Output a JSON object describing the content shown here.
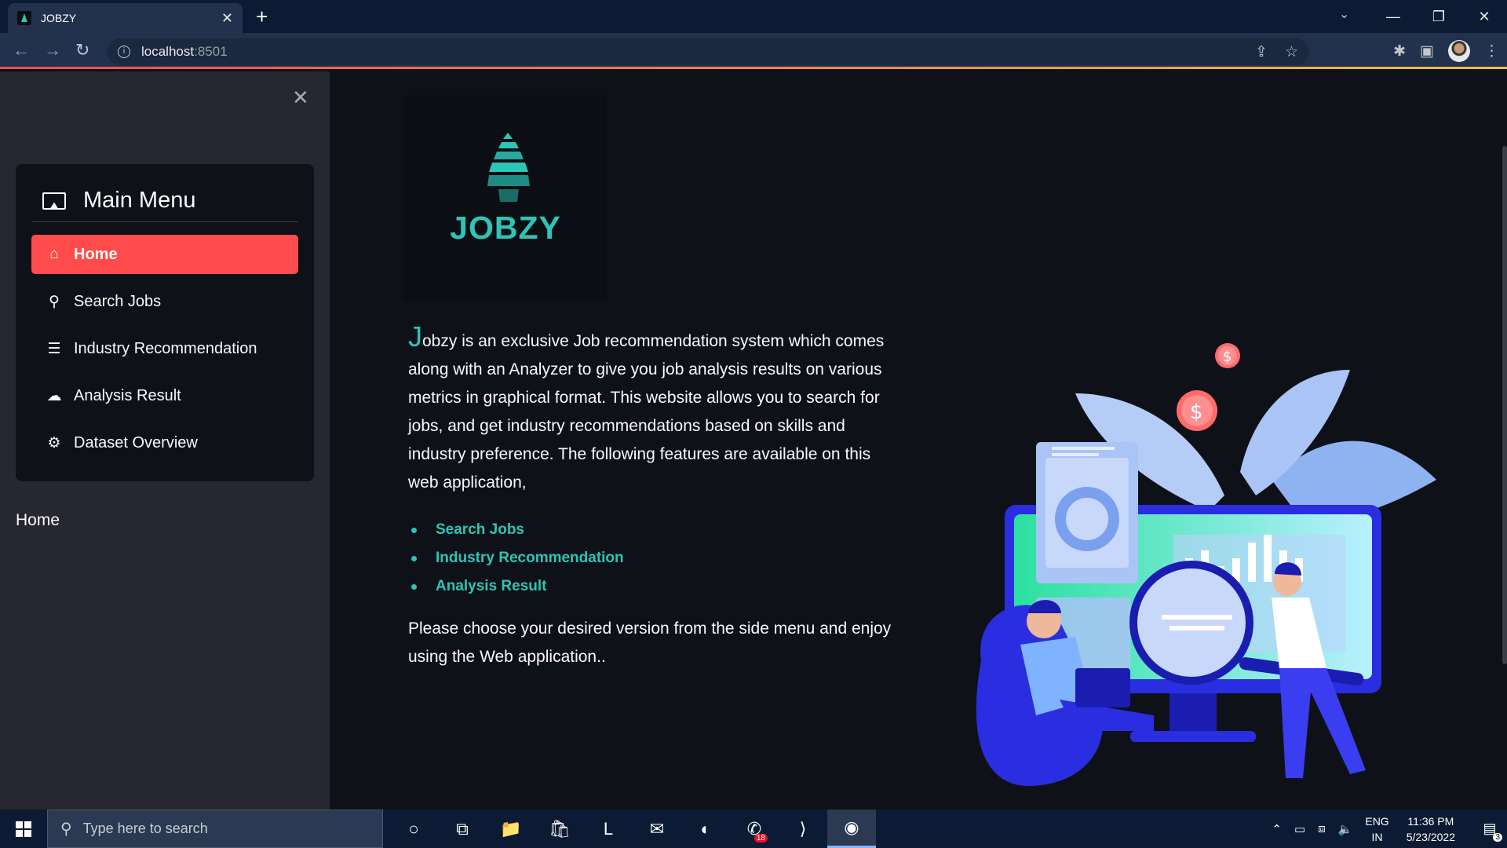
{
  "browser": {
    "tab_title": "JOBZY",
    "tab_close": "✕",
    "new_tab": "+",
    "url_host": "localhost",
    "url_port": ":8501",
    "win_minimize": "—",
    "win_restore": "❐",
    "win_close": "✕"
  },
  "sidebar": {
    "close": "✕",
    "menu_title": "Main Menu",
    "items": [
      {
        "label": "Home",
        "icon": "home-icon",
        "glyph": "⌂",
        "active": true
      },
      {
        "label": "Search Jobs",
        "icon": "search-icon",
        "glyph": "⚲",
        "active": false
      },
      {
        "label": "Industry Recommendation",
        "icon": "list-icon",
        "glyph": "☰",
        "active": false
      },
      {
        "label": "Analysis Result",
        "icon": "cloud-upload-icon",
        "glyph": "☁",
        "active": false
      },
      {
        "label": "Dataset Overview",
        "icon": "gear-icon",
        "glyph": "⚙",
        "active": false
      }
    ],
    "current_page": "Home"
  },
  "main": {
    "logo_text": "JOBZY",
    "intro_dropcap": "J",
    "intro_text": "obzy is an exclusive Job recommendation system which comes along with an Analyzer to give you job analysis results on various metrics in graphical format. This website allows you to search for jobs, and get industry recommendations based on skills and industry preference. The following features are available on this web application,",
    "features": [
      "Search Jobs",
      "Industry Recommendation",
      "Analysis Result"
    ],
    "closing": "Please choose your desired version from the side menu and enjoy using the Web application.."
  },
  "taskbar": {
    "search_placeholder": "Type here to search",
    "apps": [
      {
        "name": "cortana-icon",
        "glyph": "○"
      },
      {
        "name": "task-view-icon",
        "glyph": "⧉"
      },
      {
        "name": "file-explorer-icon",
        "glyph": "📁"
      },
      {
        "name": "store-icon",
        "glyph": "🛍"
      },
      {
        "name": "l-app-icon",
        "glyph": "L"
      },
      {
        "name": "mail-icon",
        "glyph": "✉"
      },
      {
        "name": "edge-icon",
        "glyph": "◐"
      },
      {
        "name": "whatsapp-icon",
        "glyph": "✆",
        "badge": "18"
      },
      {
        "name": "vscode-icon",
        "glyph": "⟩"
      },
      {
        "name": "chrome-icon",
        "glyph": "◉",
        "active": true
      }
    ],
    "lang_line1": "ENG",
    "lang_line2": "IN",
    "time": "11:36 PM",
    "date": "5/23/2022",
    "notification_count": "3"
  },
  "colors": {
    "accent": "#ff4b4b",
    "brand": "#2ec4b6",
    "sidebar_bg": "#262730",
    "main_bg": "#0e1117"
  }
}
